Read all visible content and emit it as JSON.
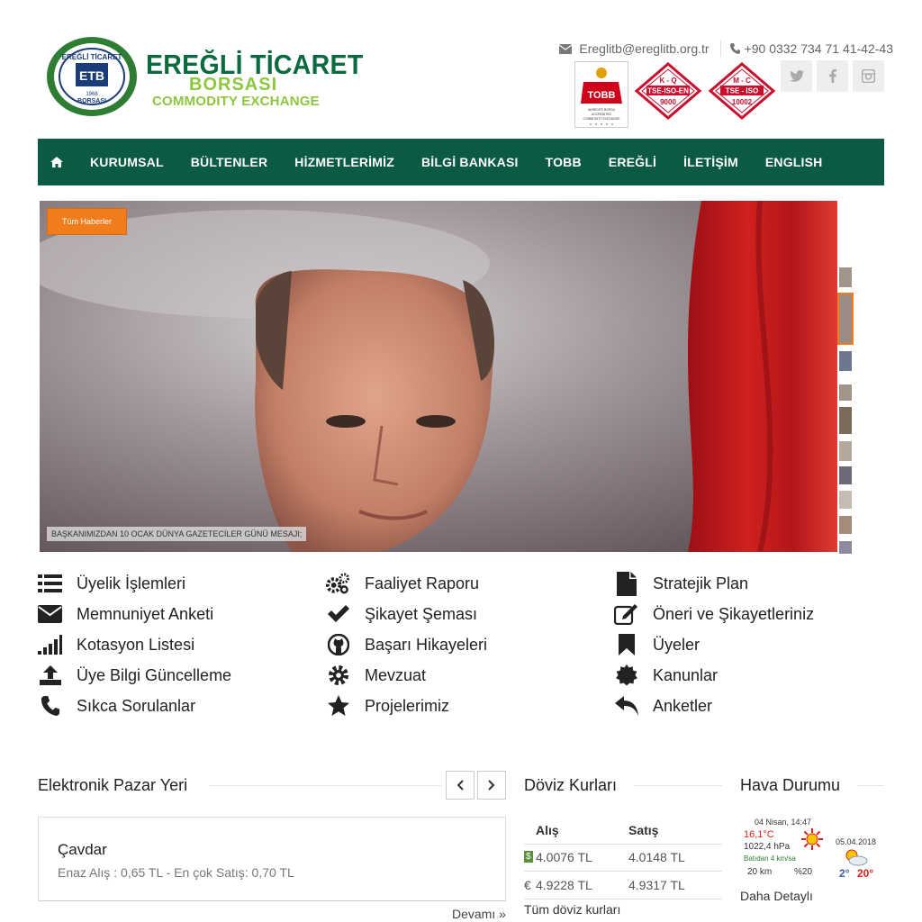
{
  "header": {
    "brand_line1": "EREĞLİ TİCARET",
    "brand_line2": "BORSASI",
    "brand_line3": "COMMODITY EXCHANGE",
    "seal_top": "EREĞLİ TİCARET",
    "seal_abbr": "ETB",
    "seal_year": "1968",
    "seal_bottom": "BORSASI",
    "email": "Ereglitb@ereglitb.org.tr",
    "phone": "+90 0332 734 71 41-42-43",
    "certs": {
      "tobb": "TOBB",
      "tobb_sub": "AKREDİTE BORSA ACCREDITED COMMODITY EXCHANGE",
      "kq_top": "K - Q",
      "kq_mid": "TSE-ISO-EN",
      "kq_bot": "9000",
      "mc_top": "M - C",
      "mc_mid": "TSE - ISO",
      "mc_bot": "10002"
    },
    "social": [
      "twitter-icon",
      "facebook-icon",
      "instagram-icon"
    ]
  },
  "nav": {
    "items": [
      "KURUMSAL",
      "BÜLTENLER",
      "HİZMETLERİMİZ",
      "BİLGİ BANKASI",
      "TOBB",
      "EREĞLİ",
      "İLETİŞİM",
      "ENGLISH"
    ]
  },
  "slider": {
    "all_news": "Tüm Haberler",
    "caption": "BAŞKANIMIZDAN 10 OCAK DÜNYA GAZETECİLER GÜNÜ MESAJI;"
  },
  "links": {
    "col1": [
      "Üyelik İşlemleri",
      "Memnuniyet Anketi",
      "Kotasyon Listesi",
      "Üye Bilgi Güncelleme",
      "Sıkca Sorulanlar"
    ],
    "col2": [
      "Faaliyet Raporu",
      "Şikayet Şeması",
      "Başarı Hikayeleri",
      "Mevzuat",
      "Projelerimiz"
    ],
    "col3": [
      "Stratejik Plan",
      "Öneri ve Şikayetleriniz",
      "Üyeler",
      "Kanunlar",
      "Anketler"
    ]
  },
  "market": {
    "title": "Elektronik Pazar Yeri",
    "item_name": "Çavdar",
    "item_desc": "Enaz Alış : 0,65 TL - En çok Satış: 0,70 TL",
    "more": "Devamı »"
  },
  "fx": {
    "title": "Döviz Kurları",
    "col_buy": "Alış",
    "col_sell": "Satış",
    "rows": [
      {
        "symbol": "$",
        "buy": "4.0076 TL",
        "sell": "4.0148 TL"
      },
      {
        "symbol": "€",
        "buy": "4.9228 TL",
        "sell": "4.9317 TL"
      }
    ],
    "all_link": "Tüm döviz kurları"
  },
  "weather": {
    "title": "Hava Durumu",
    "datetime": "04 Nisan, 14:47",
    "temp": "16,1°C",
    "pressure": "1022,4 hPa",
    "wind": "Batıdan 4 km/sa",
    "visibility": "20 km",
    "humidity": "%20",
    "next_date": "05.04.2018",
    "next_low": "2°",
    "next_high": "20°",
    "detail_link": "Daha Detaylı"
  }
}
